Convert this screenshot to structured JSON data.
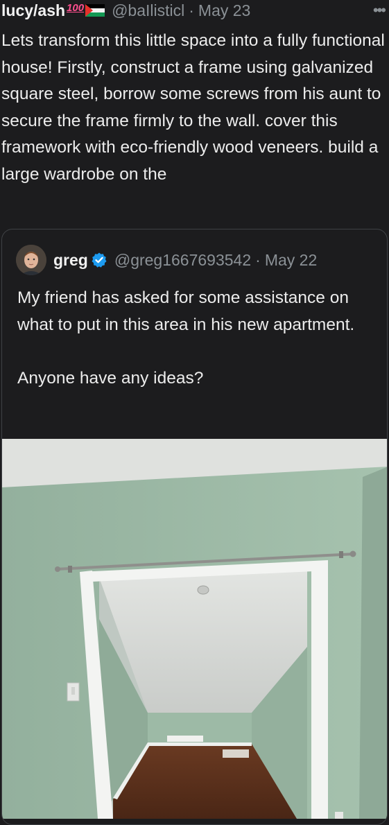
{
  "tweet": {
    "display_name": "lucy/ash",
    "name_emoji": "100",
    "handle": "@baIlisticl",
    "separator": "·",
    "date": "May 23",
    "more_icon": "more-horizontal-icon",
    "text": "Lets transform this little space into a fully functional house! Firstly, construct a frame using galvanized square steel, borrow some screws from his aunt to secure the frame firmly to the wall. cover this framework with eco-friendly wood veneers. build a large wardrobe on the"
  },
  "quoted_tweet": {
    "display_name": "greg",
    "verified_icon": "verified-badge-icon",
    "handle": "@greg1667693542",
    "separator": "·",
    "date": "May 22",
    "paragraphs": [
      "My friend has asked for some assistance on what to put in this area in his new apartment.",
      "Anyone have any ideas?"
    ],
    "media": "photo of an empty alcove with sloped ceiling, curtain rod, green walls and wood floor"
  },
  "colors": {
    "background": "#1c1c1e",
    "text": "#e7e9ea",
    "muted": "#8b9196",
    "verified": "#1d9bf0",
    "wall": "#a9c3b2"
  }
}
